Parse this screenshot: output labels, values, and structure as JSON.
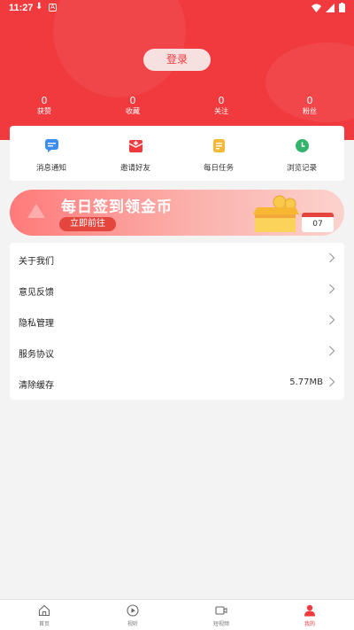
{
  "status_bar": {
    "time": "11:27"
  },
  "header": {
    "login_label": "登录"
  },
  "stats": [
    {
      "value": "0",
      "label": "获赞"
    },
    {
      "value": "0",
      "label": "收藏"
    },
    {
      "value": "0",
      "label": "关注"
    },
    {
      "value": "0",
      "label": "粉丝"
    }
  ],
  "quick_actions": [
    {
      "label": "消息通知",
      "icon": "message-icon",
      "color": "#3d8df0"
    },
    {
      "label": "邀请好友",
      "icon": "envelope-icon",
      "color": "#f03a3e"
    },
    {
      "label": "每日任务",
      "icon": "task-list-icon",
      "color": "#f5b93a"
    },
    {
      "label": "浏览记录",
      "icon": "clock-icon",
      "color": "#34b36b"
    }
  ],
  "banner": {
    "title": "每日签到领金币",
    "subtitle": "立即前往",
    "calendar_day": "07"
  },
  "menu": [
    {
      "label": "关于我们",
      "value": ""
    },
    {
      "label": "意见反馈",
      "value": ""
    },
    {
      "label": "隐私管理",
      "value": ""
    },
    {
      "label": "服务协议",
      "value": ""
    },
    {
      "label": "清除缓存",
      "value": "5.77MB"
    }
  ],
  "bottom_nav": [
    {
      "label": "首页",
      "icon": "home-icon"
    },
    {
      "label": "视听",
      "icon": "play-icon"
    },
    {
      "label": "短视频",
      "icon": "video-camera-icon"
    },
    {
      "label": "我的",
      "icon": "user-icon",
      "active": true
    }
  ],
  "colors": {
    "brand_red": "#f03a3e",
    "background": "#f3f3f3"
  }
}
